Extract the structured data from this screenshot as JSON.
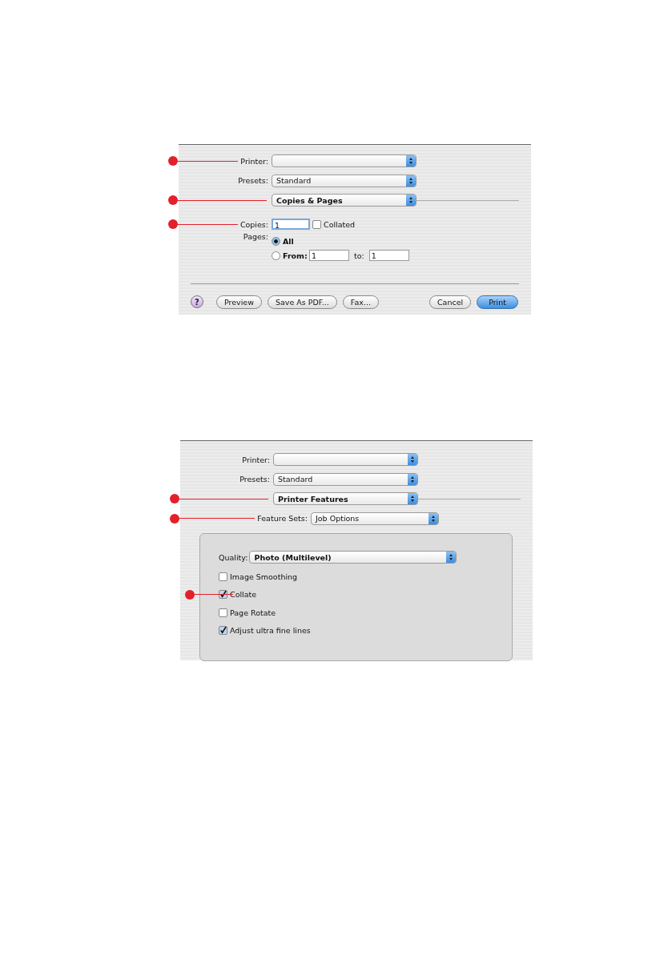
{
  "dialogs": [
    {
      "rows": [
        {
          "kind": "popup",
          "label": "Printer:",
          "callout": true
        },
        {
          "kind": "popup",
          "label": "Presets:",
          "value": "Standard",
          "callout": false
        },
        {
          "kind": "section",
          "value": "Copies & Pages",
          "callout": true
        },
        {
          "kind": "copies",
          "label": "Copies:",
          "value": "1",
          "check_label": "Collated",
          "checked": false,
          "callout": true
        },
        {
          "kind": "pages",
          "label": "Pages:",
          "callout": false,
          "options": [
            {
              "label": "All",
              "selected": true
            },
            {
              "label": "From:",
              "selected": false,
              "from": "1",
              "to_label": "to:",
              "to": "1"
            }
          ]
        }
      ],
      "help_label": "?",
      "left_buttons": [
        {
          "label": "Preview",
          "default": false
        },
        {
          "label": "Save As PDF...",
          "default": false
        },
        {
          "label": "Fax...",
          "default": false
        }
      ],
      "right_buttons": [
        {
          "label": "Cancel",
          "default": false
        },
        {
          "label": "Print",
          "default": true
        }
      ]
    },
    {
      "rows": [
        {
          "kind": "popup",
          "label": "Printer:",
          "callout": false
        },
        {
          "kind": "popup",
          "label": "Presets:",
          "value": "Standard",
          "callout": false
        },
        {
          "kind": "section",
          "value": "Printer Features",
          "callout": true
        },
        {
          "kind": "subpopup",
          "label": "Feature Sets:",
          "value": "Job Options",
          "callout": true
        }
      ],
      "panel": {
        "quality": {
          "label": "Quality:",
          "value": "Photo (Multilevel)"
        },
        "options": [
          {
            "label": "Image Smoothing",
            "checked": false,
            "callout": false
          },
          {
            "label": "Collate",
            "checked": true,
            "callout": true
          },
          {
            "label": "Page Rotate",
            "checked": false,
            "callout": false
          },
          {
            "label": "Adjust ultra fine lines",
            "checked": true,
            "callout": false
          }
        ]
      }
    }
  ]
}
